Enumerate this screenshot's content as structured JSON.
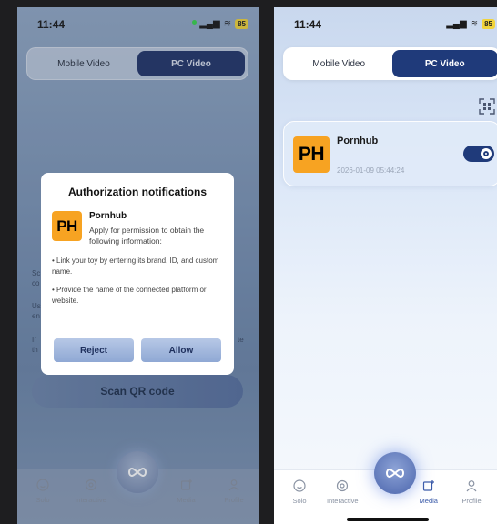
{
  "left": {
    "status": {
      "time": "11:44",
      "battery": "85"
    },
    "segment": {
      "mobile": "Mobile Video",
      "pc": "PC Video"
    },
    "background_text": {
      "line1": "Sc",
      "line2": "co",
      "line3": "Us",
      "line4": "en",
      "line5": "If",
      "line6": "th",
      "trail": "te"
    },
    "scan_button": "Scan QR code",
    "modal": {
      "title": "Authorization notifications",
      "app_name": "Pornhub",
      "app_logo": "PH",
      "description": "Apply for permission to obtain the following information:",
      "permission1": "• Link your toy by entering its brand, ID, and custom name.",
      "permission2": "• Provide the name of the connected platform or website.",
      "reject": "Reject",
      "allow": "Allow"
    },
    "tabs": {
      "solo": "Solo",
      "interactive": "Interactive",
      "media": "Media",
      "profile": "Profile"
    }
  },
  "right": {
    "status": {
      "time": "11:44",
      "battery": "85"
    },
    "segment": {
      "mobile": "Mobile Video",
      "pc": "PC Video"
    },
    "device": {
      "name": "Pornhub",
      "logo": "PH",
      "date": "2026-01-09 05:44:24",
      "enabled": true
    },
    "tabs": {
      "solo": "Solo",
      "interactive": "Interactive",
      "media": "Media",
      "profile": "Profile"
    }
  },
  "colors": {
    "accent": "#1f3a7a",
    "logo_orange": "#f7a322",
    "battery": "#f1d43b"
  }
}
